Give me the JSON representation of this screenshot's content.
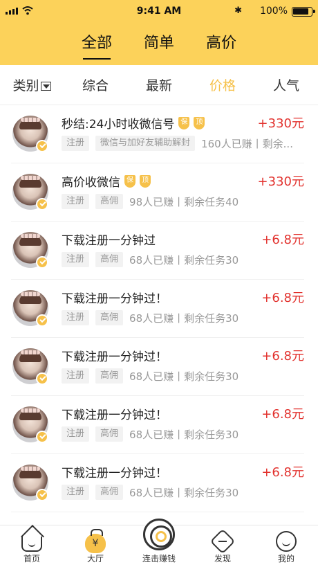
{
  "status_bar": {
    "time": "9:41 AM",
    "battery": "100%"
  },
  "top_tabs": [
    {
      "label": "全部",
      "active": true
    },
    {
      "label": "简单",
      "active": false
    },
    {
      "label": "高价",
      "active": false
    }
  ],
  "sort_bar": [
    {
      "label": "类别",
      "active": false,
      "has_dropdown": true
    },
    {
      "label": "综合",
      "active": false
    },
    {
      "label": "最新",
      "active": false
    },
    {
      "label": "价格",
      "active": true
    },
    {
      "label": "人气",
      "active": false
    }
  ],
  "tasks": [
    {
      "title": "秒结:24小时收微信号",
      "badges": [
        "保",
        "顶"
      ],
      "reward": "+330元",
      "tags": [
        "注册",
        "微信与加好友辅助解封"
      ],
      "meta": "160人已赚丨剩余..."
    },
    {
      "title": "高价收微信",
      "badges": [
        "保",
        "顶"
      ],
      "reward": "+330元",
      "tags": [
        "注册",
        "高佣"
      ],
      "meta": "98人已赚丨剩余任务40"
    },
    {
      "title": "下载注册一分钟过",
      "badges": [],
      "reward": "+6.8元",
      "tags": [
        "注册",
        "高佣"
      ],
      "meta": "68人已赚丨剩余任务30"
    },
    {
      "title": "下载注册一分钟过！",
      "badges": [],
      "reward": "+6.8元",
      "tags": [
        "注册",
        "高佣"
      ],
      "meta": "68人已赚丨剩余任务30"
    },
    {
      "title": "下载注册一分钟过！",
      "badges": [],
      "reward": "+6.8元",
      "tags": [
        "注册",
        "高佣"
      ],
      "meta": "68人已赚丨剩余任务30"
    },
    {
      "title": "下载注册一分钟过！",
      "badges": [],
      "reward": "+6.8元",
      "tags": [
        "注册",
        "高佣"
      ],
      "meta": "68人已赚丨剩余任务30"
    },
    {
      "title": "下载注册一分钟过！",
      "badges": [],
      "reward": "+6.8元",
      "tags": [
        "注册",
        "高佣"
      ],
      "meta": "68人已赚丨剩余任务30"
    }
  ],
  "bottom_nav": [
    {
      "label": "首页",
      "icon": "home-icon"
    },
    {
      "label": "大厅",
      "icon": "money-bag-icon",
      "glyph": "¥"
    },
    {
      "label": "连击赚钱",
      "icon": "target-icon"
    },
    {
      "label": "发现",
      "icon": "discover-icon"
    },
    {
      "label": "我的",
      "icon": "profile-icon"
    }
  ],
  "colors": {
    "brand_yellow": "#FCD25A",
    "accent": "#F6C14A",
    "price_red": "#E2322E"
  }
}
